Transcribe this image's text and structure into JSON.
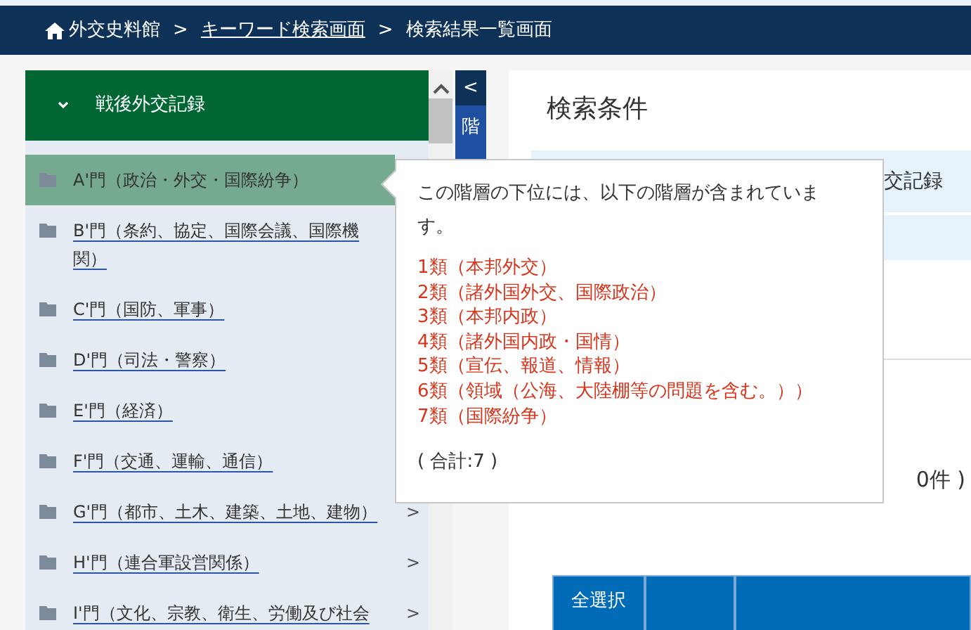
{
  "breadcrumb": [
    {
      "label": "外交史料館",
      "kind": "home"
    },
    {
      "label": "キーワード検索画面",
      "kind": "link",
      "separator": ">"
    },
    {
      "label": "検索結果一覧画面",
      "kind": "current",
      "separator": ">"
    }
  ],
  "sidebar": {
    "title": "戦後外交記録",
    "expanded": true,
    "items": [
      {
        "label": "A'門（政治・外交・国際紛争）",
        "selected": true
      },
      {
        "label": "B'門（条約、協定、国際会議、国際機関）",
        "selected": false
      },
      {
        "label": "C'門（国防、軍事）",
        "selected": false
      },
      {
        "label": "D'門（司法・警察）",
        "selected": false
      },
      {
        "label": "E'門（経済）",
        "selected": false
      },
      {
        "label": "F'門（交通、運輸、通信）",
        "selected": false
      },
      {
        "label": "G'門（都市、土木、建築、土地、建物）",
        "selected": false,
        "arrow": ">"
      },
      {
        "label": "H'門（連合軍設営関係）",
        "selected": false,
        "arrow": ">"
      },
      {
        "label": "I'門（文化、宗教、衛生、労働及び社会",
        "selected": false,
        "arrow": ">"
      }
    ]
  },
  "collapse_tab": {
    "toggle": "<",
    "label": "階"
  },
  "main": {
    "title": "検索条件",
    "condition_rows": [
      {
        "value": "交記録"
      }
    ],
    "result_count": "0件 )",
    "table": {
      "columns": [
        "全選択"
      ]
    }
  },
  "tooltip": {
    "intro": "この階層の下位には、以下の階層が含まれています。",
    "children": [
      "1類（本邦外交）",
      "2類（諸外国外交、国際政治）",
      "3類（本邦内政）",
      "4類（諸外国内政・国情）",
      "5類（宣伝、報道、情報）",
      "6類（領域（公海、大陸棚等の問題を含む。））",
      "7類（国際紛争）"
    ],
    "total": "( 合計:7 )"
  }
}
